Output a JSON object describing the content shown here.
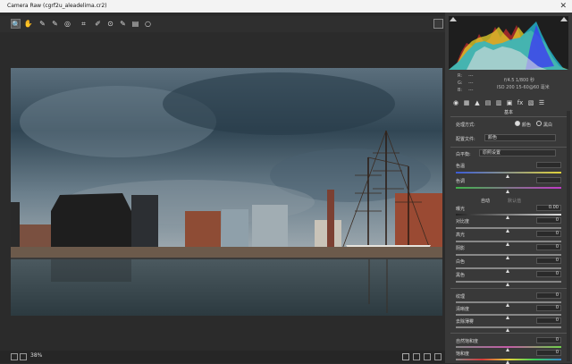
{
  "window": {
    "title": "Camera Raw (cgrf2u_aleadelima.cr2)",
    "close": "✕"
  },
  "status": {
    "zoom": "38%"
  },
  "info": {
    "rgb_r": "R:",
    "rgb_g": "G:",
    "rgb_b": "B:",
    "dash1": "---",
    "dash2": "---",
    "dash3": "---",
    "exposure": "f/4.5   1/800 秒",
    "iso": "ISO 200   15-60@60 毫米"
  },
  "panel": {
    "section": "基本",
    "treatment_label": "处理方式:",
    "treatment_color": "颜色",
    "treatment_bw": "黑白",
    "profile_label": "配置文件:",
    "profile_value": "颜色",
    "wb_label": "白平衡:",
    "wb_value": "原照设置",
    "temp_label": "色温",
    "tint_label": "色调",
    "auto": "自动",
    "default": "默认值",
    "exposure_label": "曝光",
    "exposure_value": "0.00",
    "contrast_label": "对比度",
    "contrast_value": "0",
    "highlights_label": "高光",
    "highlights_value": "0",
    "shadows_label": "阴影",
    "shadows_value": "0",
    "whites_label": "白色",
    "whites_value": "0",
    "blacks_label": "黑色",
    "blacks_value": "0",
    "texture_label": "纹理",
    "texture_value": "0",
    "clarity_label": "清晰度",
    "clarity_value": "0",
    "dehaze_label": "去除薄雾",
    "dehaze_value": "0",
    "vibrance_label": "自然饱和度",
    "vibrance_value": "0",
    "saturation_label": "饱和度",
    "saturation_value": "0"
  },
  "colors": {
    "panel": "#393939",
    "canvas": "#2b2b2b",
    "titlebar": "#f3f3f3"
  }
}
